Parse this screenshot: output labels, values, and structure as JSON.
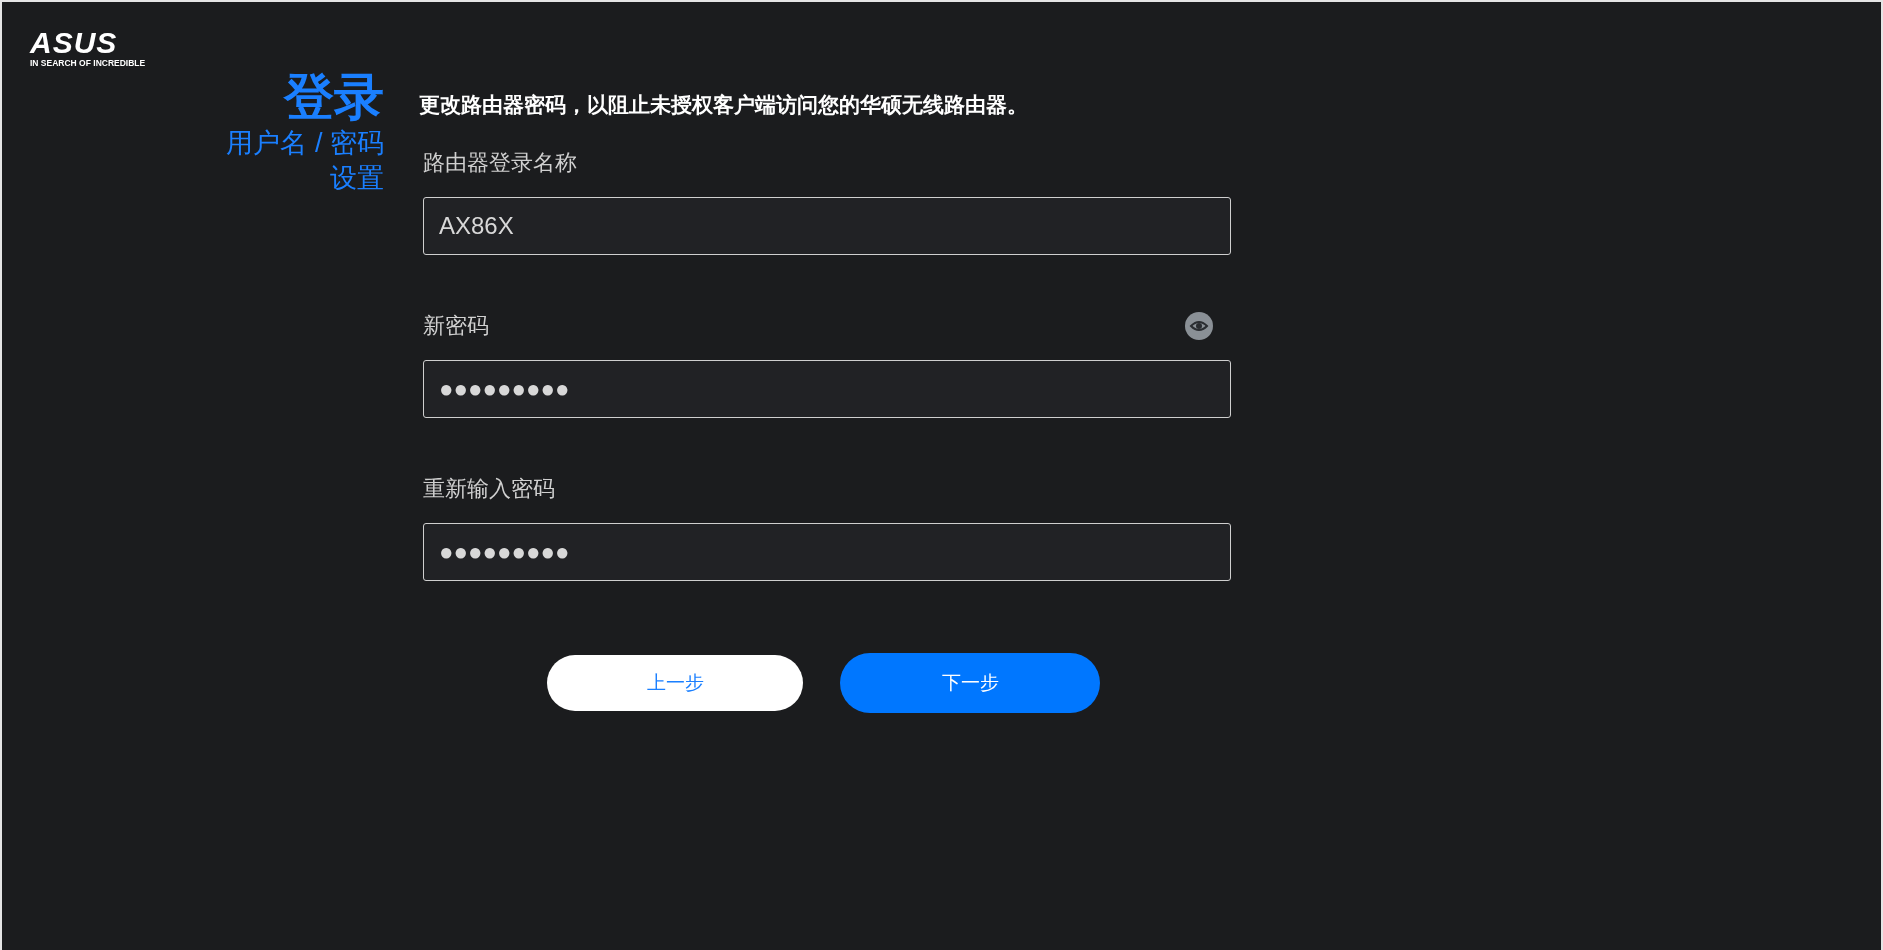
{
  "logo": {
    "brand": "ASUS",
    "tagline": "IN SEARCH OF INCREDIBLE"
  },
  "heading": {
    "title": "登录",
    "subtitle": "用户名 / 密码设置"
  },
  "description": "更改路由器密码，以阻止未授权客户端访问您的华硕无线路由器。",
  "fields": [
    {
      "label": "路由器登录名称",
      "value": "AX86X",
      "show_password_toggle": false
    },
    {
      "label": "新密码",
      "value": "●●●●●●●●●",
      "show_password_toggle": true
    },
    {
      "label": "重新输入密码",
      "value": "●●●●●●●●●",
      "show_password_toggle": false
    }
  ],
  "buttons": [
    {
      "label": "上一步",
      "kind": "secondary"
    },
    {
      "label": "下一步",
      "kind": "primary"
    }
  ]
}
